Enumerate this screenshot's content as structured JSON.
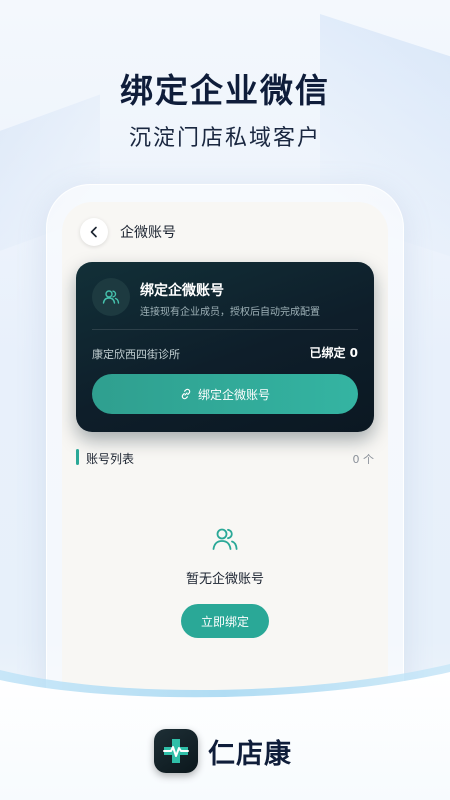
{
  "promo": {
    "headline": "绑定企业微信",
    "subline": "沉淀门店私域客户"
  },
  "nav": {
    "back_icon": "chevron-left-icon",
    "title": "企微账号"
  },
  "bind_card": {
    "icon": "users-icon",
    "title": "绑定企微账号",
    "description": "连接现有企业成员，授权后自动完成配置",
    "clinic_name": "康定欣西四街诊所",
    "bound_status": "已绑定 0",
    "button_icon": "link-icon",
    "button_label": "绑定企微账号"
  },
  "account_list": {
    "title": "账号列表",
    "count": "0 个"
  },
  "empty_state": {
    "icon": "users-icon",
    "text": "暂无企微账号",
    "button_label": "立即绑定"
  },
  "brand": {
    "logo_icon": "medical-cross-pulse-icon",
    "name": "仁店康"
  },
  "colors": {
    "accent": "#2aa897",
    "card_bg": "#0e1e2a",
    "headline": "#0f1d3a"
  }
}
